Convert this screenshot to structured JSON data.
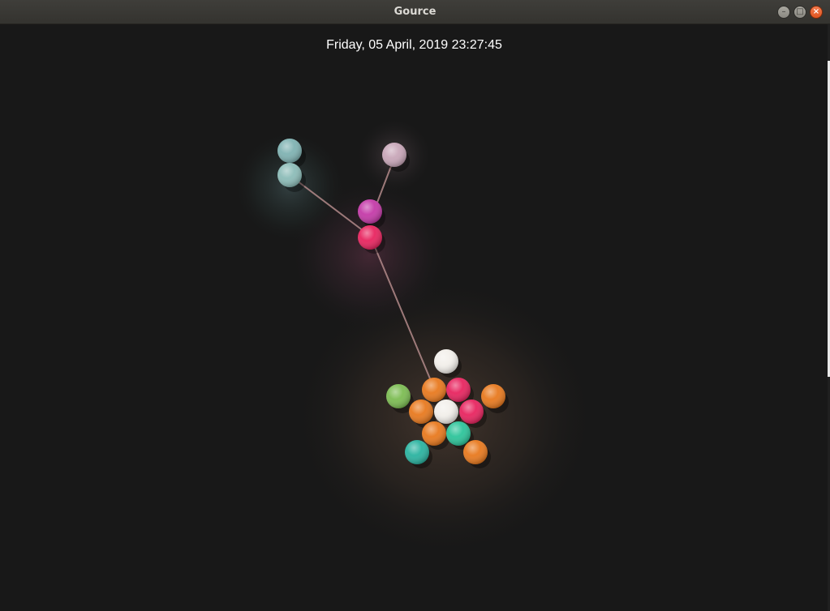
{
  "window": {
    "title": "Gource",
    "controls": {
      "minimize": "–",
      "maximize": "□",
      "close": "×"
    }
  },
  "overlay": {
    "datetime": "Friday, 05 April, 2019 23:27:45"
  },
  "colors": {
    "background": "#181818",
    "orange": "#e8791e",
    "pink": "#e8245f",
    "magenta": "#c43aa8",
    "white": "#f2efea",
    "green": "#7cbc52",
    "teal": "#2ab3a0",
    "mint": "#2cc49a",
    "grey_teal": "#7fb2b2",
    "mauve": "#c8a6b8",
    "edge": "#b38a8a"
  }
}
